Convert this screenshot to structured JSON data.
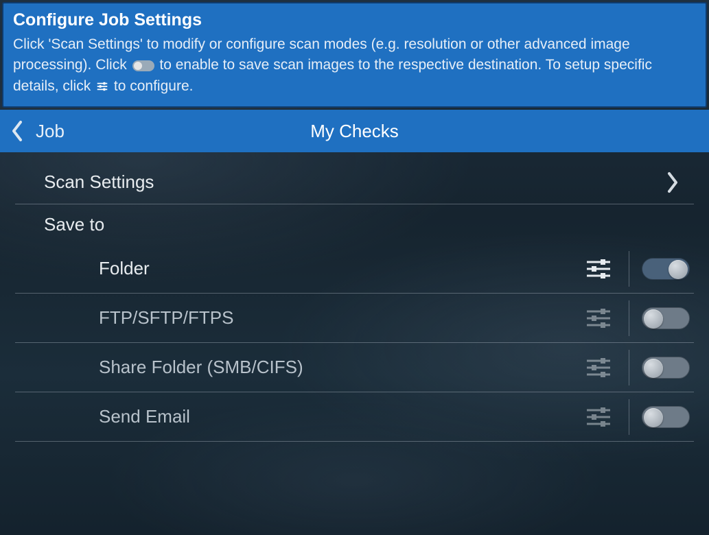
{
  "banner": {
    "title": "Configure Job Settings",
    "text_before_toggle": "Click 'Scan Settings' to modify or configure scan modes (e.g. resolution or other advanced image processing).  Click ",
    "text_between": " to enable to save scan images to the respective destination. To setup specific details, click ",
    "text_after": " to configure."
  },
  "header": {
    "back_label": "Job",
    "title": "My Checks"
  },
  "rows": {
    "scan_settings": "Scan Settings",
    "save_to": "Save to"
  },
  "destinations": [
    {
      "label": "Folder",
      "enabled": true
    },
    {
      "label": "FTP/SFTP/FTPS",
      "enabled": false
    },
    {
      "label": "Share Folder (SMB/CIFS)",
      "enabled": false
    },
    {
      "label": "Send Email",
      "enabled": false
    }
  ]
}
